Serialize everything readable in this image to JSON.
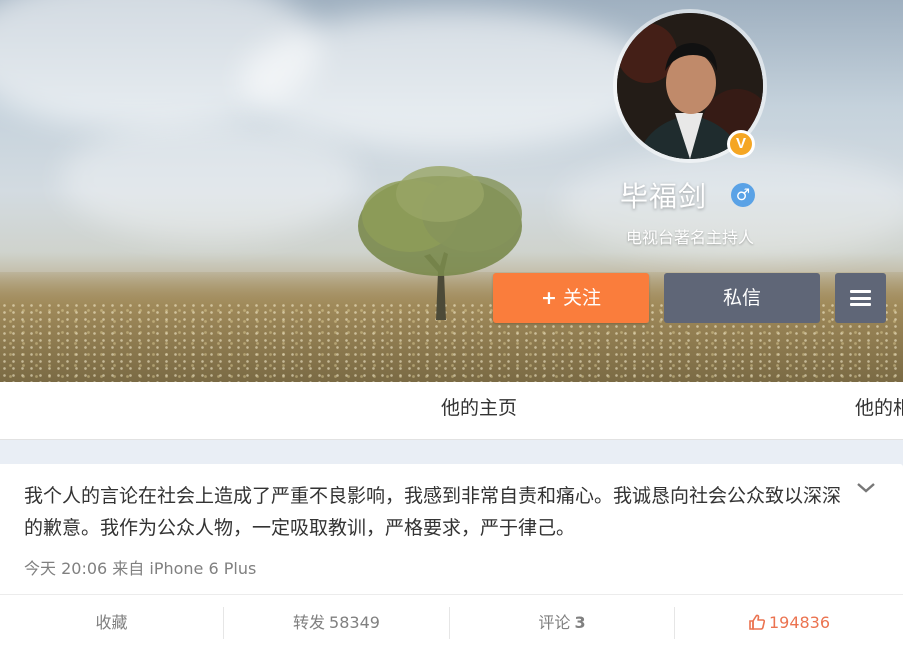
{
  "profile": {
    "name": "毕福剑",
    "title": "电视台著名主持人",
    "verified_badge": "V",
    "gender_icon": "male-icon",
    "follow_plus": "+",
    "follow_label": "关注",
    "message_label": "私信",
    "more_icon": "menu-icon"
  },
  "tabs": {
    "home": "他的主页",
    "photos": "他的相"
  },
  "post": {
    "text": "我个人的言论在社会上造成了严重不良影响，我感到非常自责和痛心。我诚恳向社会公众致以深深的歉意。我作为公众人物，一定吸取教训，严格要求，严于律己。",
    "meta": "今天 20:06 来自 iPhone 6 Plus",
    "expand_icon": "chevron-down-icon",
    "actions": {
      "favorite_label": "收藏",
      "repost_label": "转发",
      "repost_count": "58349",
      "comment_label": "评论",
      "comment_count": "3",
      "like_count": "194836",
      "like_icon": "thumbs-up-icon"
    }
  },
  "colors": {
    "follow": "#fa7d3c",
    "message": "#5f6677",
    "like": "#eb7350",
    "verified": "#f5a623",
    "gender": "#5aa2e6"
  }
}
